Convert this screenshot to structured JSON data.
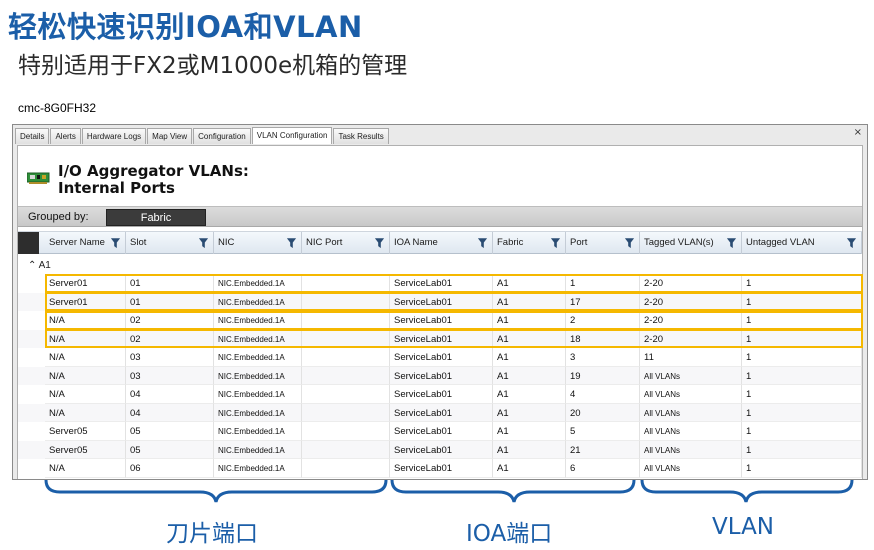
{
  "slide": {
    "title": "轻松快速识别IOA和VLAN",
    "subtitle": "特别适用于FX2或M1000e机箱的管理"
  },
  "host": "cmc-8G0FH32",
  "tabs": [
    {
      "label": "Details",
      "active": false
    },
    {
      "label": "Alerts",
      "active": false
    },
    {
      "label": "Hardware Logs",
      "active": false
    },
    {
      "label": "Map View",
      "active": false
    },
    {
      "label": "Configuration",
      "active": false
    },
    {
      "label": "VLAN Configuration",
      "active": true
    },
    {
      "label": "Task Results",
      "active": false
    }
  ],
  "close_glyph": "×",
  "panel": {
    "title_line1": "I/O Aggregator VLANs:",
    "title_line2": "Internal Ports",
    "icon": "network-card-icon"
  },
  "grouping": {
    "label": "Grouped by:",
    "value": "Fabric"
  },
  "columns": [
    "Server Name",
    "Slot",
    "NIC",
    "NIC Port",
    "IOA Name",
    "Fabric",
    "Port",
    "Tagged VLAN(s)",
    "Untagged VLAN"
  ],
  "group_row": {
    "chevron": "⌃",
    "label": "A1"
  },
  "rows": [
    {
      "server": "Server01",
      "slot": "01",
      "nic": "NIC.Embedded.1A",
      "nic_port": "",
      "ioa": "ServiceLab01",
      "fabric": "A1",
      "port": "1",
      "tagged": "2-20",
      "untagged": "1",
      "highlighted": true
    },
    {
      "server": "Server01",
      "slot": "01",
      "nic": "NIC.Embedded.1A",
      "nic_port": "",
      "ioa": "ServiceLab01",
      "fabric": "A1",
      "port": "17",
      "tagged": "2-20",
      "untagged": "1",
      "highlighted": true
    },
    {
      "server": "N/A",
      "slot": "02",
      "nic": "NIC.Embedded.1A",
      "nic_port": "",
      "ioa": "ServiceLab01",
      "fabric": "A1",
      "port": "2",
      "tagged": "2-20",
      "untagged": "1",
      "highlighted": true
    },
    {
      "server": "N/A",
      "slot": "02",
      "nic": "NIC.Embedded.1A",
      "nic_port": "",
      "ioa": "ServiceLab01",
      "fabric": "A1",
      "port": "18",
      "tagged": "2-20",
      "untagged": "1",
      "highlighted": true
    },
    {
      "server": "N/A",
      "slot": "03",
      "nic": "NIC.Embedded.1A",
      "nic_port": "",
      "ioa": "ServiceLab01",
      "fabric": "A1",
      "port": "3",
      "tagged": "11",
      "untagged": "1",
      "highlighted": false
    },
    {
      "server": "N/A",
      "slot": "03",
      "nic": "NIC.Embedded.1A",
      "nic_port": "",
      "ioa": "ServiceLab01",
      "fabric": "A1",
      "port": "19",
      "tagged": "All VLANs",
      "untagged": "1",
      "highlighted": false
    },
    {
      "server": "N/A",
      "slot": "04",
      "nic": "NIC.Embedded.1A",
      "nic_port": "",
      "ioa": "ServiceLab01",
      "fabric": "A1",
      "port": "4",
      "tagged": "All VLANs",
      "untagged": "1",
      "highlighted": false
    },
    {
      "server": "N/A",
      "slot": "04",
      "nic": "NIC.Embedded.1A",
      "nic_port": "",
      "ioa": "ServiceLab01",
      "fabric": "A1",
      "port": "20",
      "tagged": "All VLANs",
      "untagged": "1",
      "highlighted": false
    },
    {
      "server": "Server05",
      "slot": "05",
      "nic": "NIC.Embedded.1A",
      "nic_port": "",
      "ioa": "ServiceLab01",
      "fabric": "A1",
      "port": "5",
      "tagged": "All VLANs",
      "untagged": "1",
      "highlighted": false
    },
    {
      "server": "Server05",
      "slot": "05",
      "nic": "NIC.Embedded.1A",
      "nic_port": "",
      "ioa": "ServiceLab01",
      "fabric": "A1",
      "port": "21",
      "tagged": "All VLANs",
      "untagged": "1",
      "highlighted": false
    },
    {
      "server": "N/A",
      "slot": "06",
      "nic": "NIC.Embedded.1A",
      "nic_port": "",
      "ioa": "ServiceLab01",
      "fabric": "A1",
      "port": "6",
      "tagged": "All VLANs",
      "untagged": "1",
      "highlighted": false
    }
  ],
  "annotations": {
    "blade_ports": "刀片端口",
    "ioa_ports": "IOA端口",
    "vlan": "VLAN"
  },
  "colors": {
    "title_blue": "#1b5ea8",
    "highlight": "#f5b800",
    "brace": "#1b5ea8"
  }
}
